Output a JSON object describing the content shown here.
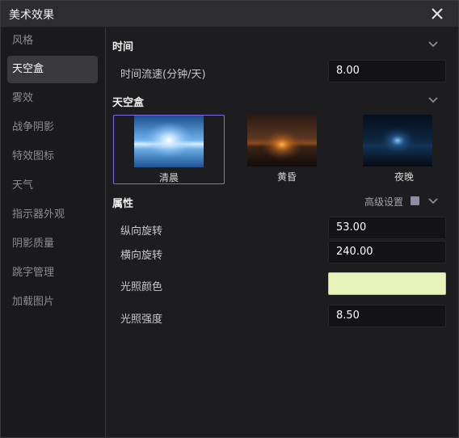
{
  "window": {
    "title": "美术效果"
  },
  "sidebar": {
    "items": [
      {
        "label": "风格"
      },
      {
        "label": "天空盒"
      },
      {
        "label": "雾效"
      },
      {
        "label": "战争阴影"
      },
      {
        "label": "特效图标"
      },
      {
        "label": "天气"
      },
      {
        "label": "指示器外观"
      },
      {
        "label": "阴影质量"
      },
      {
        "label": "跳字管理"
      },
      {
        "label": "加载图片"
      }
    ],
    "active": "天空盒"
  },
  "time_section": {
    "title": "时间",
    "flow_speed_label": "时间流速(分钟/天)",
    "flow_speed_value": "8.00"
  },
  "skybox_section": {
    "title": "天空盒",
    "options": [
      {
        "label": "清晨",
        "selected": true
      },
      {
        "label": "黄昏",
        "selected": false
      },
      {
        "label": "夜晚",
        "selected": false
      }
    ]
  },
  "props_section": {
    "title": "属性",
    "advanced_label": "高级设置",
    "vertical_rotation_label": "纵向旋转",
    "vertical_rotation_value": "53.00",
    "horizontal_rotation_label": "横向旋转",
    "horizontal_rotation_value": "240.00",
    "light_color_label": "光照颜色",
    "light_color": "#e7f3b9",
    "light_intensity_label": "光照强度",
    "light_intensity_value": "8.50"
  },
  "colors": {
    "accent": "#7a6ee8",
    "panel": "#1d1d1f",
    "input_bg": "#131315"
  }
}
